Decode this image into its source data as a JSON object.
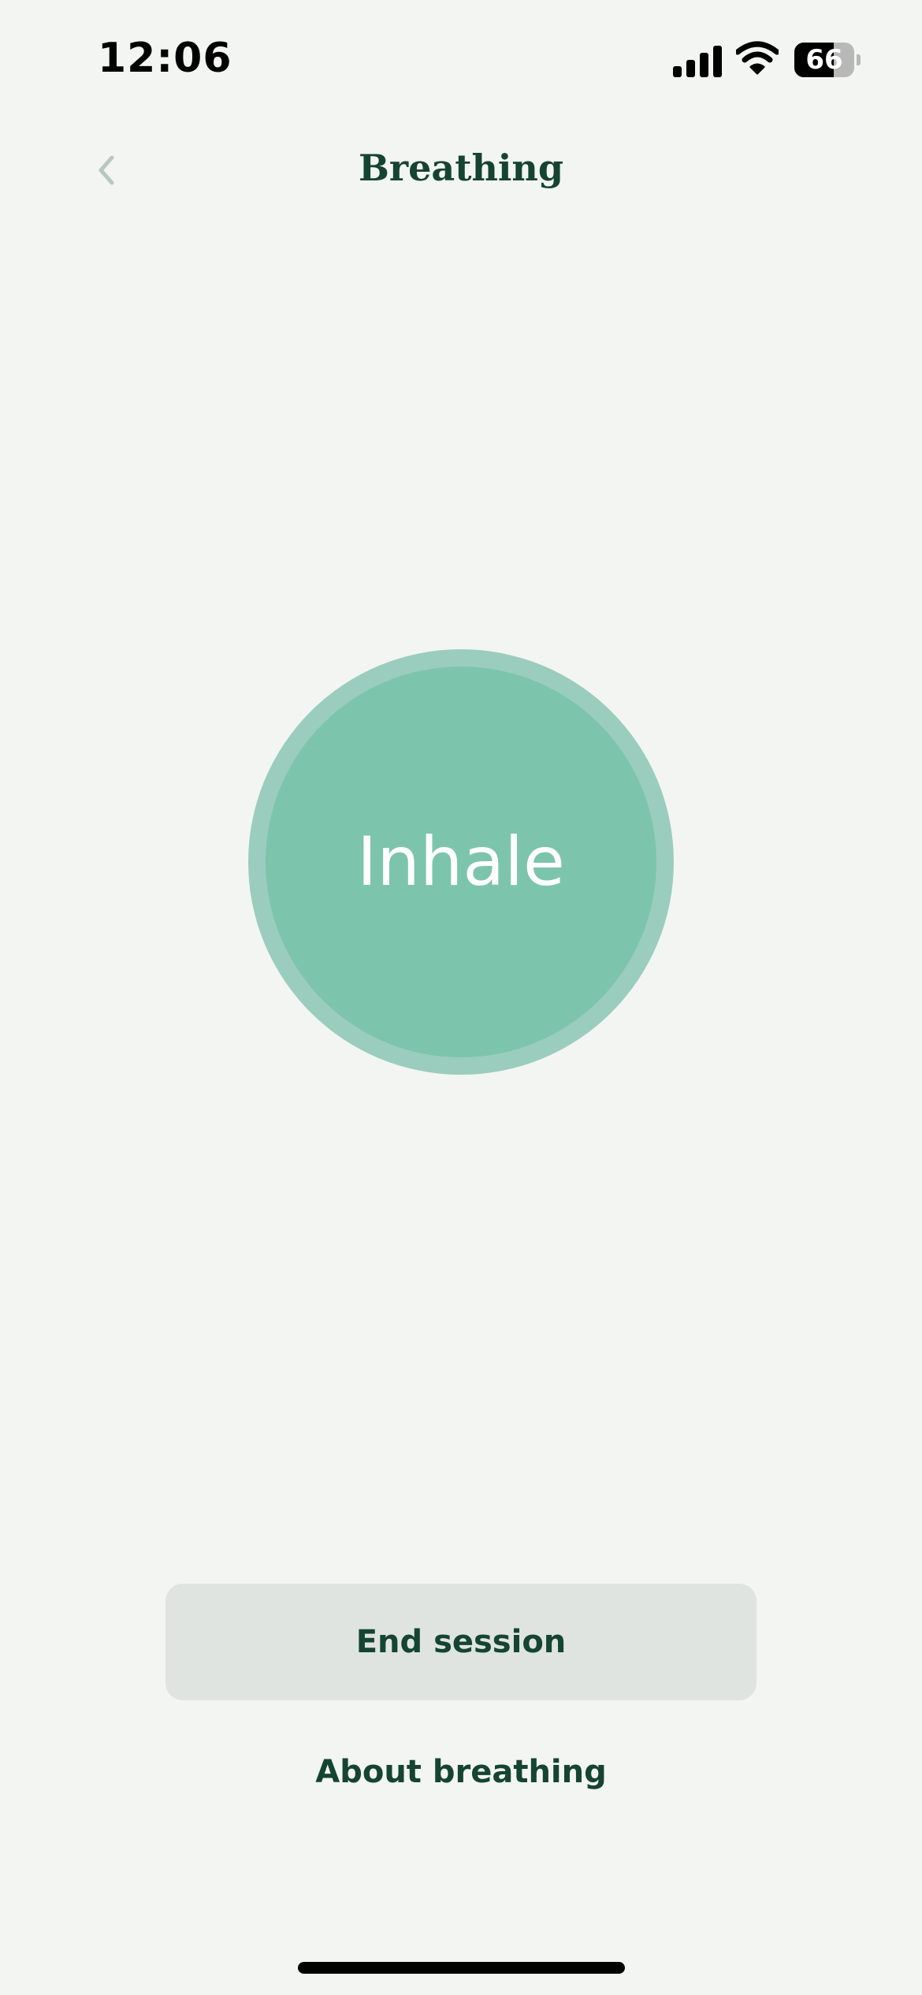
{
  "status_bar": {
    "time": "12:06",
    "battery_percent": "66",
    "battery_level": 0.66,
    "icons": [
      "signal-icon",
      "wifi-icon",
      "battery-icon"
    ]
  },
  "header": {
    "title": "Breathing",
    "back_icon": "chevron-left-icon"
  },
  "breathing": {
    "phase_label": "Inhale",
    "outer_color": "#9acdbd",
    "inner_color": "#7dc4ac"
  },
  "actions": {
    "end_session_label": "End session",
    "about_label": "About breathing"
  },
  "colors": {
    "background": "#f3f5f2",
    "text_primary": "#154432",
    "button_background": "#dfe4e1"
  }
}
